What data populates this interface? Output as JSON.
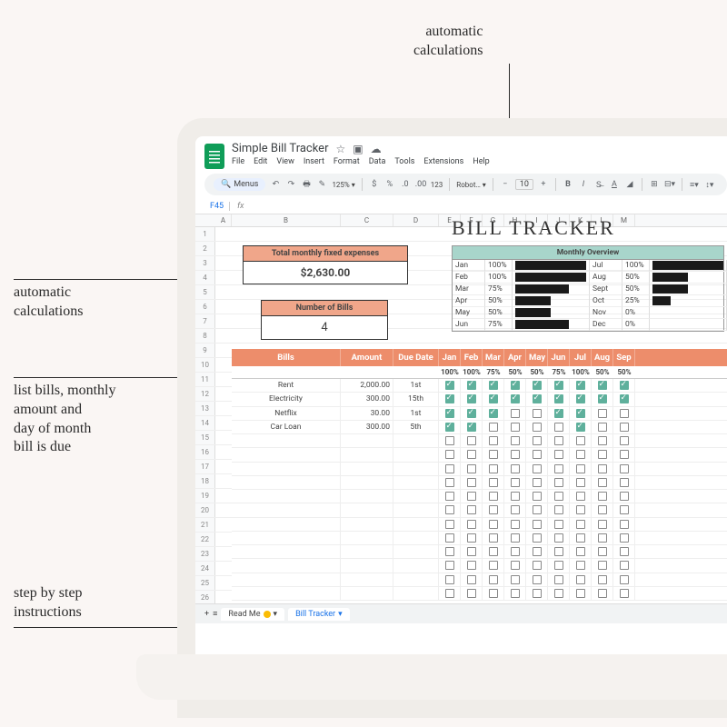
{
  "annotations": {
    "top": "automatic\ncalculations",
    "left_auto": "automatic\ncalculations",
    "left_bills": "list bills, monthly\namount and\nday of month\nbill is due",
    "instructions": "step by step\ninstructions"
  },
  "app": {
    "title": "Simple Bill Tracker",
    "menu": [
      "File",
      "Edit",
      "View",
      "Insert",
      "Format",
      "Data",
      "Tools",
      "Extensions",
      "Help"
    ],
    "toolbar": {
      "search_label": "Menus",
      "zoom": "125%",
      "currency": "$",
      "percent": "%",
      "decimals": "123",
      "font": "Robot…",
      "font_size": "10"
    },
    "cell_ref": "F45",
    "columns": [
      "A",
      "B",
      "C",
      "D",
      "E",
      "F",
      "G",
      "H",
      "I",
      "J",
      "K",
      "L",
      "M"
    ],
    "sheet_tabs": {
      "readme": "Read Me",
      "tracker": "Bill Tracker"
    }
  },
  "page": {
    "title": "BILL TRACKER",
    "total_expenses": {
      "label": "Total monthly fixed expenses",
      "value": "$2,630.00"
    },
    "num_bills": {
      "label": "Number of Bills",
      "value": "4"
    },
    "overview": {
      "title": "Monthly Overview",
      "rows": [
        {
          "m1": "Jan",
          "p1": "100%",
          "b1": 100,
          "m2": "Jul",
          "p2": "100%",
          "b2": 100
        },
        {
          "m1": "Feb",
          "p1": "100%",
          "b1": 100,
          "m2": "Aug",
          "p2": "50%",
          "b2": 50
        },
        {
          "m1": "Mar",
          "p1": "75%",
          "b1": 75,
          "m2": "Sept",
          "p2": "50%",
          "b2": 50
        },
        {
          "m1": "Apr",
          "p1": "50%",
          "b1": 50,
          "m2": "Oct",
          "p2": "25%",
          "b2": 25
        },
        {
          "m1": "May",
          "p1": "50%",
          "b1": 50,
          "m2": "Nov",
          "p2": "0%",
          "b2": 0
        },
        {
          "m1": "Jun",
          "p1": "75%",
          "b1": 75,
          "m2": "Dec",
          "p2": "0%",
          "b2": 0
        }
      ]
    },
    "table": {
      "headers": {
        "bills": "Bills",
        "amount": "Amount",
        "due": "Due Date"
      },
      "months": [
        "Jan",
        "Feb",
        "Mar",
        "Apr",
        "May",
        "Jun",
        "Jul",
        "Aug",
        "Sep"
      ],
      "percents": [
        "100%",
        "100%",
        "75%",
        "50%",
        "50%",
        "75%",
        "100%",
        "50%",
        "50%"
      ],
      "rows": [
        {
          "name": "Rent",
          "amount": "2,000.00",
          "due": "1st",
          "checks": [
            1,
            1,
            1,
            1,
            1,
            1,
            1,
            1,
            1
          ]
        },
        {
          "name": "Electricity",
          "amount": "300.00",
          "due": "15th",
          "checks": [
            1,
            1,
            1,
            1,
            1,
            1,
            1,
            1,
            1
          ]
        },
        {
          "name": "Netflix",
          "amount": "30.00",
          "due": "1st",
          "checks": [
            1,
            1,
            1,
            0,
            0,
            1,
            1,
            0,
            0
          ]
        },
        {
          "name": "Car Loan",
          "amount": "300.00",
          "due": "5th",
          "checks": [
            1,
            1,
            0,
            0,
            0,
            0,
            1,
            0,
            0
          ]
        }
      ]
    }
  }
}
